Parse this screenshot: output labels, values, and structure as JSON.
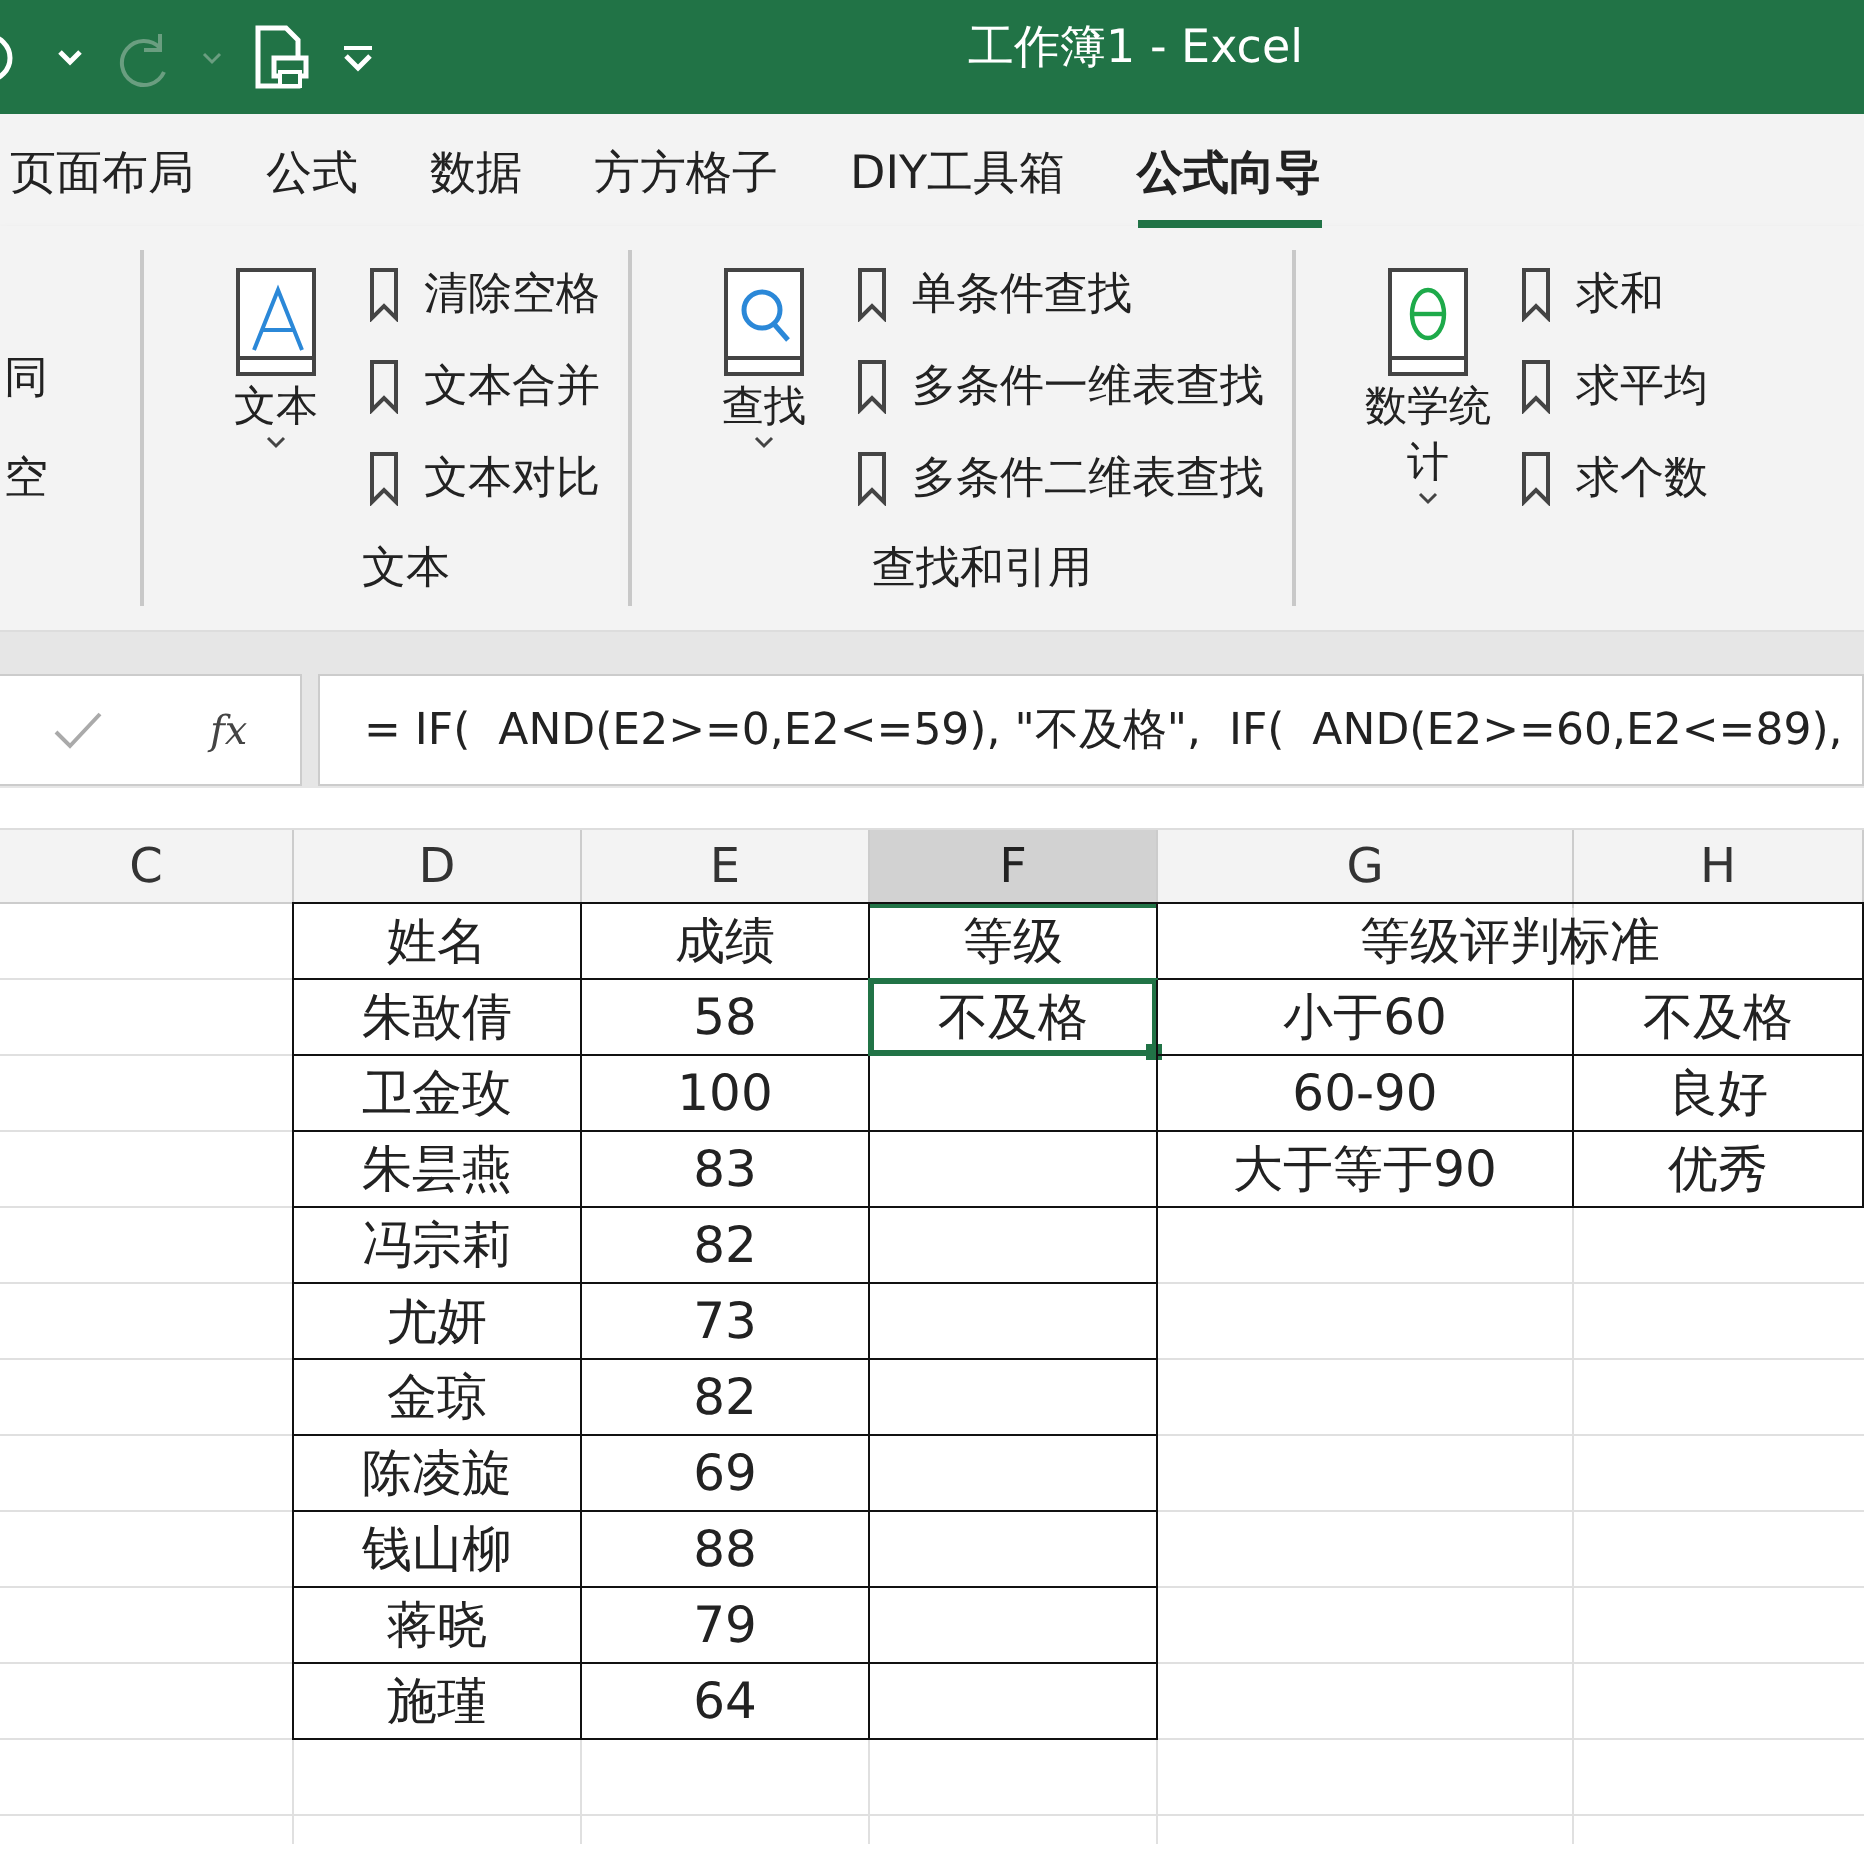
{
  "title_bar": {
    "title": "工作簿1 - Excel"
  },
  "tabs": [
    {
      "label": "页面布局",
      "selected": false
    },
    {
      "label": "公式",
      "selected": false
    },
    {
      "label": "数据",
      "selected": false
    },
    {
      "label": "方方格子",
      "selected": false
    },
    {
      "label": "DIY工具箱",
      "selected": false
    },
    {
      "label": "公式向导",
      "selected": true
    }
  ],
  "ribbon": {
    "groups": [
      {
        "items": [
          "同",
          "空"
        ]
      },
      {
        "big_button": {
          "label": "文本",
          "kind": "letter"
        },
        "items": [
          "清除空格",
          "文本合并",
          "文本对比"
        ],
        "label": "文本"
      },
      {
        "big_button": {
          "label": "查找",
          "kind": "search"
        },
        "items": [
          "单条件查找",
          "多条件一维表查找",
          "多条件二维表查找"
        ],
        "label": "查找和引用"
      },
      {
        "big_button": {
          "label": "数学统计",
          "kind": "theta"
        },
        "items": [
          "求和",
          "求平均",
          "求个数"
        ]
      }
    ]
  },
  "formula_bar": {
    "function_button": "fx",
    "formula": "= IF(  AND(E2>=0,E2<=59), \"不及格\",  IF(  AND(E2>=60,E2<=89),"
  },
  "sheet": {
    "columns": [
      {
        "label": "C",
        "selected": false
      },
      {
        "label": "D",
        "selected": false
      },
      {
        "label": "E",
        "selected": false
      },
      {
        "label": "F",
        "selected": true
      },
      {
        "label": "G",
        "selected": false
      },
      {
        "label": "H",
        "selected": false
      }
    ],
    "rows": [
      {
        "cells": [
          {
            "text": "",
            "selected": false
          },
          {
            "text": "姓名",
            "selected": false
          },
          {
            "text": "成绩",
            "selected": false
          },
          {
            "text": "等级",
            "selected": false
          },
          {
            "text": "等级评判标准",
            "selected": false
          }
        ]
      },
      {
        "cells": [
          {
            "text": "",
            "selected": false
          },
          {
            "text": "朱敔倩",
            "selected": false
          },
          {
            "text": "58",
            "selected": false
          },
          {
            "text": "不及格",
            "selected": true
          },
          {
            "text": "小于60",
            "selected": false
          },
          {
            "text": "不及格",
            "selected": false
          }
        ]
      },
      {
        "cells": [
          {
            "text": "",
            "selected": false
          },
          {
            "text": "卫金玫",
            "selected": false
          },
          {
            "text": "100",
            "selected": false
          },
          {
            "text": "",
            "selected": false
          },
          {
            "text": "60-90",
            "selected": false
          },
          {
            "text": "良好",
            "selected": false
          }
        ]
      },
      {
        "cells": [
          {
            "text": "",
            "selected": false
          },
          {
            "text": "朱昙燕",
            "selected": false
          },
          {
            "text": "83",
            "selected": false
          },
          {
            "text": "",
            "selected": false
          },
          {
            "text": "大于等于90",
            "selected": false
          },
          {
            "text": "优秀",
            "selected": false
          }
        ]
      },
      {
        "cells": [
          {
            "text": "",
            "selected": false
          },
          {
            "text": "冯宗莉",
            "selected": false
          },
          {
            "text": "82",
            "selected": false
          },
          {
            "text": "",
            "selected": false
          },
          {
            "text": "",
            "selected": false
          },
          {
            "text": "",
            "selected": false
          }
        ]
      },
      {
        "cells": [
          {
            "text": "",
            "selected": false
          },
          {
            "text": "尤妍",
            "selected": false
          },
          {
            "text": "73",
            "selected": false
          },
          {
            "text": "",
            "selected": false
          },
          {
            "text": "",
            "selected": false
          },
          {
            "text": "",
            "selected": false
          }
        ]
      },
      {
        "cells": [
          {
            "text": "",
            "selected": false
          },
          {
            "text": "金琼",
            "selected": false
          },
          {
            "text": "82",
            "selected": false
          },
          {
            "text": "",
            "selected": false
          },
          {
            "text": "",
            "selected": false
          },
          {
            "text": "",
            "selected": false
          }
        ]
      },
      {
        "cells": [
          {
            "text": "",
            "selected": false
          },
          {
            "text": "陈凌旋",
            "selected": false
          },
          {
            "text": "69",
            "selected": false
          },
          {
            "text": "",
            "selected": false
          },
          {
            "text": "",
            "selected": false
          },
          {
            "text": "",
            "selected": false
          }
        ]
      },
      {
        "cells": [
          {
            "text": "",
            "selected": false
          },
          {
            "text": "钱山柳",
            "selected": false
          },
          {
            "text": "88",
            "selected": false
          },
          {
            "text": "",
            "selected": false
          },
          {
            "text": "",
            "selected": false
          },
          {
            "text": "",
            "selected": false
          }
        ]
      },
      {
        "cells": [
          {
            "text": "",
            "selected": false
          },
          {
            "text": "蒋晓",
            "selected": false
          },
          {
            "text": "79",
            "selected": false
          },
          {
            "text": "",
            "selected": false
          },
          {
            "text": "",
            "selected": false
          },
          {
            "text": "",
            "selected": false
          }
        ]
      },
      {
        "cells": [
          {
            "text": "",
            "selected": false
          },
          {
            "text": "施瑾",
            "selected": false
          },
          {
            "text": "64",
            "selected": false
          },
          {
            "text": "",
            "selected": false
          },
          {
            "text": "",
            "selected": false
          },
          {
            "text": "",
            "selected": false
          }
        ]
      }
    ]
  }
}
